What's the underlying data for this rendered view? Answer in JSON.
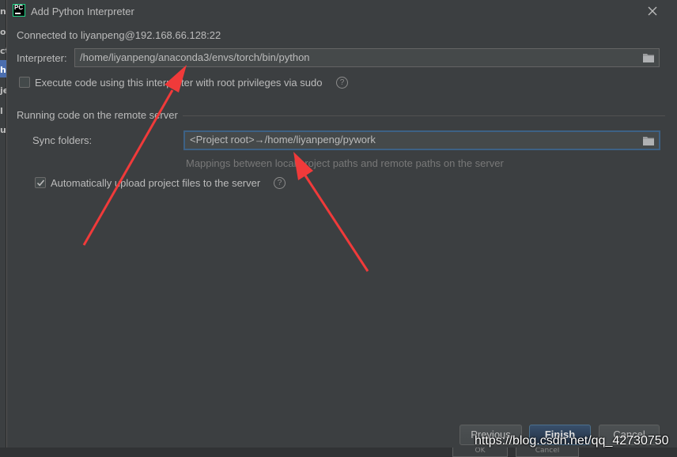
{
  "background": {
    "left_fragments": [
      "n:",
      "o",
      "ct",
      "h",
      "je",
      "l",
      "ua"
    ],
    "bottom_buttons": [
      "OK",
      "Cancel"
    ]
  },
  "dialog": {
    "title": "Add Python Interpreter",
    "app_icon_text": "PC",
    "connected_to": "Connected to liyanpeng@192.168.66.128:22",
    "interpreter_label": "Interpreter:",
    "interpreter_value": "/home/liyanpeng/anaconda3/envs/torch/bin/python",
    "sudo_checkbox_label": "Execute code using this interpreter with root privileges via sudo",
    "sudo_checked": false,
    "section_title": "Running code on the remote server",
    "sync_label": "Sync folders:",
    "sync_value": "<Project root>→/home/liyanpeng/pywork",
    "sync_hint": "Mappings between local project paths and remote paths on the server",
    "upload_checkbox_label": "Automatically upload project files to the server",
    "upload_checked": true,
    "buttons": {
      "previous": "Previous",
      "finish": "Finish",
      "cancel": "Cancel"
    }
  },
  "watermark": "https://blog.csdn.net/qq_42730750",
  "colors": {
    "background": "#3c3f41",
    "field_bg": "#45494a",
    "focus_border": "#3d6185",
    "primary_button": "#365880",
    "annotation_arrow": "#f03a3a",
    "app_icon_accent": "#21d789"
  }
}
